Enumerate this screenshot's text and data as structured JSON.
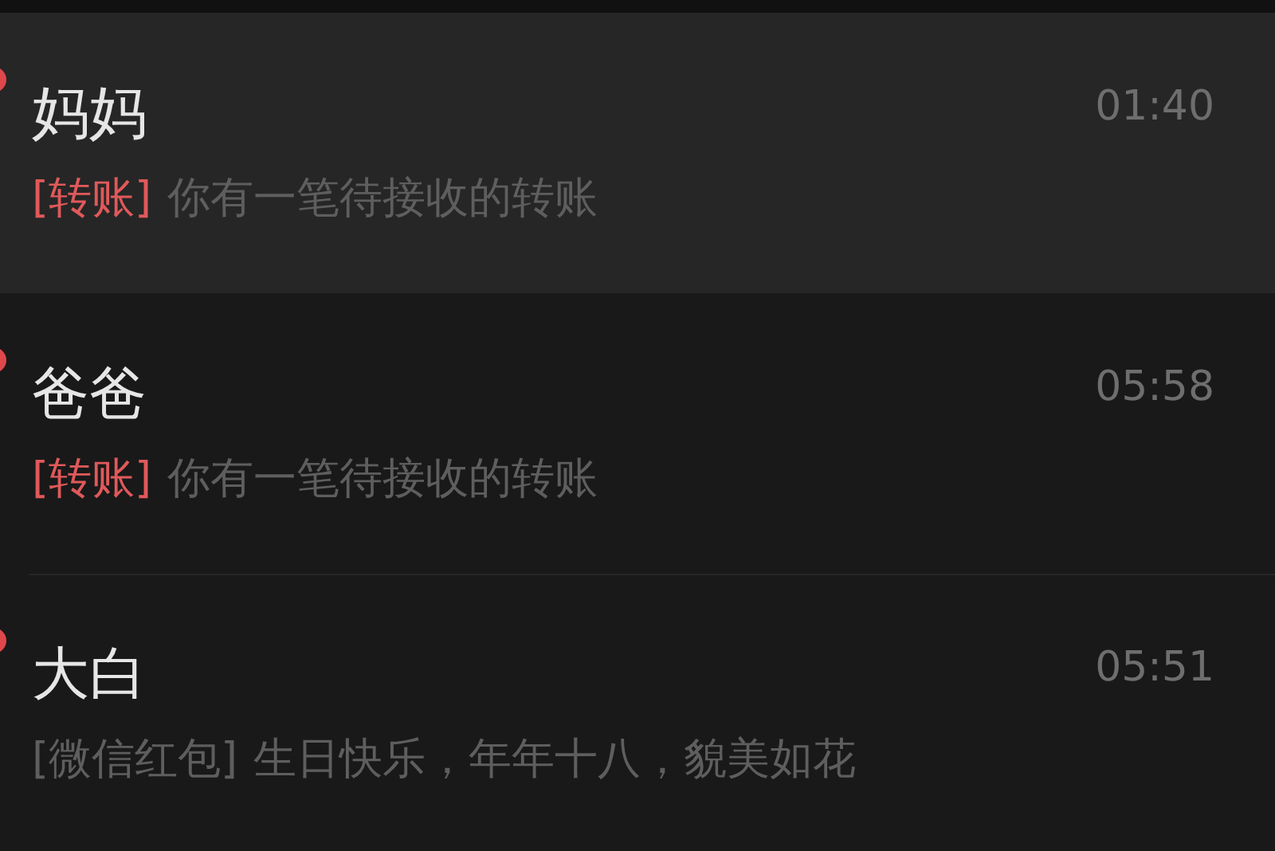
{
  "chats": [
    {
      "name": "妈妈",
      "time": "01:40",
      "tag": "[转账]",
      "tag_alert": true,
      "preview": "你有一笔待接收的转账",
      "selected": true,
      "unread": true
    },
    {
      "name": "爸爸",
      "time": "05:58",
      "tag": "[转账]",
      "tag_alert": true,
      "preview": "你有一笔待接收的转账",
      "selected": false,
      "unread": true
    },
    {
      "name": "大白",
      "time": "05:51",
      "tag": "[微信红包]",
      "tag_alert": false,
      "preview": "生日快乐，年年十八，貌美如花",
      "selected": false,
      "unread": true
    }
  ]
}
